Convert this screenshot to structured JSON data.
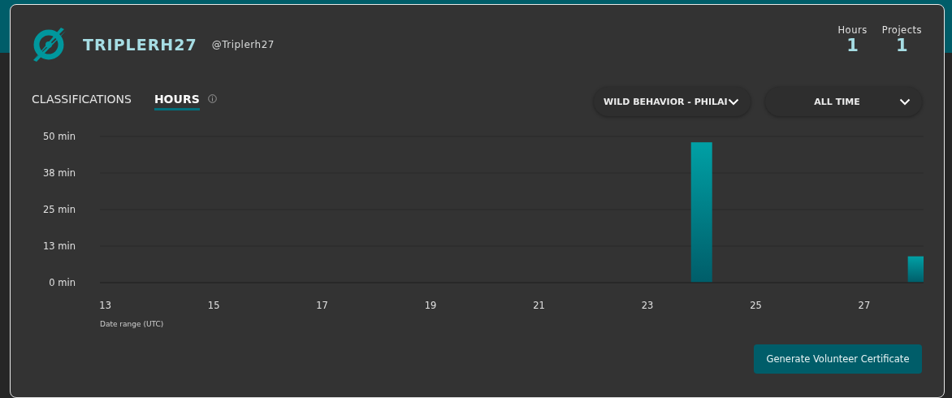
{
  "profile": {
    "display_name": "TRIPLERH27",
    "username": "@Triplerh27"
  },
  "stats": [
    {
      "label": "Hours",
      "value": "1"
    },
    {
      "label": "Projects",
      "value": "1"
    }
  ],
  "tabs": [
    {
      "label": "CLASSIFICATIONS",
      "selected": false,
      "info": false
    },
    {
      "label": "HOURS",
      "selected": true,
      "info": true
    }
  ],
  "filters": [
    {
      "value": "WILD BEHAVIOR - PHILAI"
    },
    {
      "value": "ALL TIME"
    }
  ],
  "chart_data": {
    "type": "bar",
    "xlabel": "Date range (UTC)",
    "x": [
      24,
      28
    ],
    "values": [
      48,
      9
    ],
    "xlim": [
      12.9,
      28.2
    ],
    "xticks": [
      13,
      15,
      17,
      19,
      21,
      23,
      25,
      27
    ],
    "ylim": [
      0,
      50
    ],
    "yticks": [
      {
        "value": 0,
        "label": "0 min"
      },
      {
        "value": 12.5,
        "label": "13 min"
      },
      {
        "value": 25,
        "label": "25 min"
      },
      {
        "value": 37.5,
        "label": "38 min"
      },
      {
        "value": 50,
        "label": "50 min"
      }
    ]
  },
  "certificate_button": "Generate Volunteer Certificate"
}
